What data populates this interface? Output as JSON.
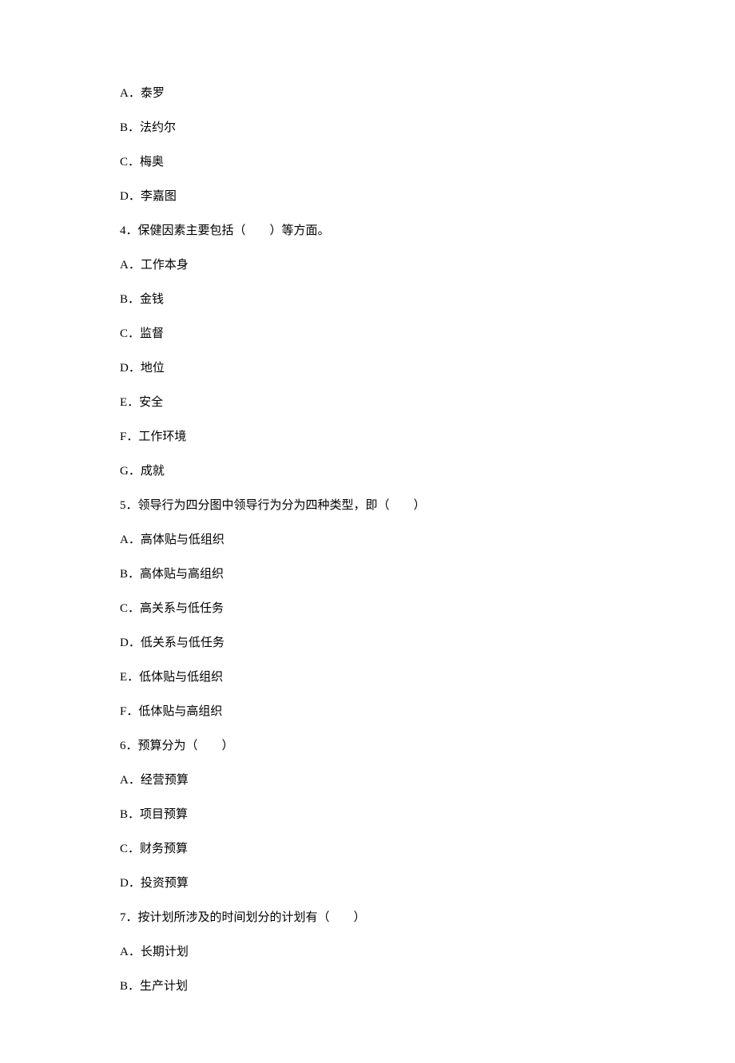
{
  "lines": [
    "A．泰罗",
    "B．法约尔",
    "C．梅奥",
    "D．李嘉图",
    "4．保健因素主要包括（　　）等方面。",
    "A．工作本身",
    "B．金钱",
    "C．监督",
    "D．地位",
    "E．安全",
    "F．工作环境",
    "G．成就",
    "5．领导行为四分图中领导行为分为四种类型，即（　　）",
    "A．高体贴与低组织",
    "B．高体贴与高组织",
    "C．高关系与低任务",
    "D．低关系与低任务",
    "E．低体贴与低组织",
    "F．低体贴与高组织",
    "6．预算分为（　　）",
    "A．经营预算",
    "B．项目预算",
    "C．财务预算",
    "D．投资预算",
    "7．按计划所涉及的时间划分的计划有（　　）",
    "A．长期计划",
    "B．生产计划"
  ]
}
